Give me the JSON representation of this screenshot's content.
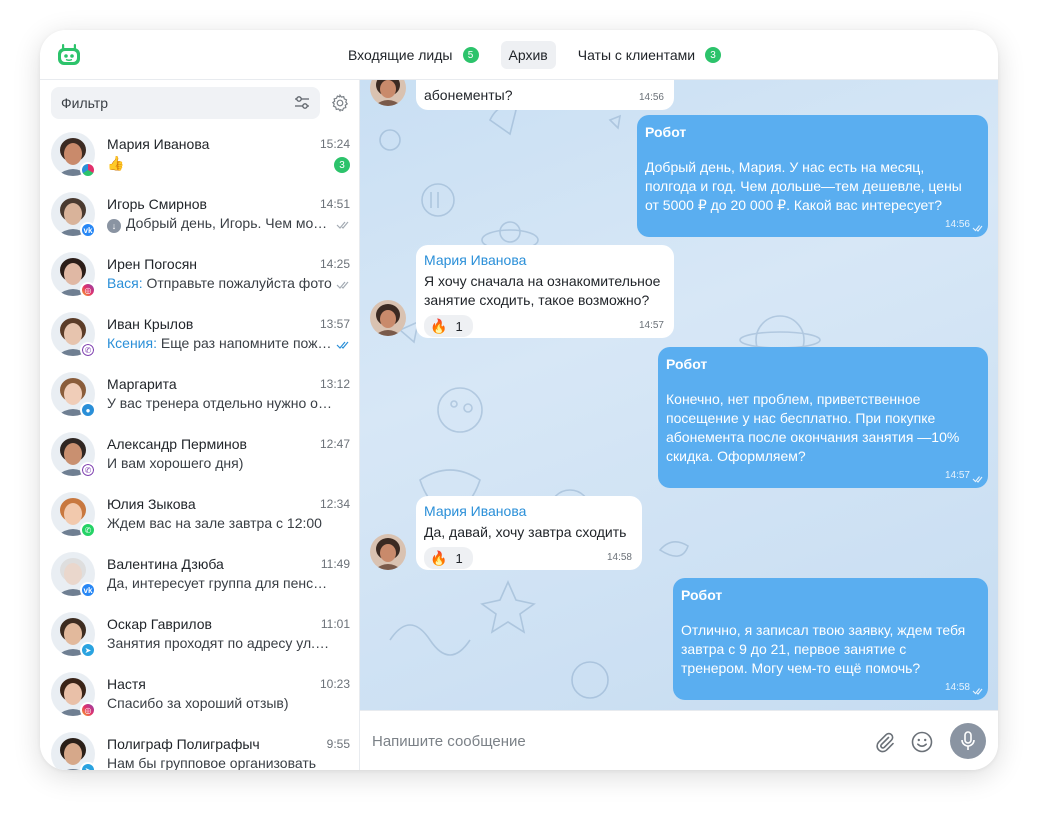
{
  "header": {
    "tabs": [
      {
        "label": "Входящие лиды",
        "badge": "5"
      },
      {
        "label": "Архив",
        "badge": ""
      },
      {
        "label": "Чаты с клиентами",
        "badge": "3"
      }
    ],
    "active_tab": 1,
    "accent_color": "#2cc36b"
  },
  "sidebar": {
    "filter_placeholder": "Фильтр",
    "chats": [
      {
        "name": "Мария Иванова",
        "time": "15:24",
        "sender": "",
        "preview": "👍",
        "unread": "3",
        "network": "multi",
        "status": "unread"
      },
      {
        "name": "Игорь Смирнов",
        "time": "14:51",
        "sender": "",
        "preview": "Добрый день, Игорь. Чем можем помочь?",
        "unread": "",
        "network": "vk",
        "status": "sent"
      },
      {
        "name": "Ирен Погосян",
        "time": "14:25",
        "sender": "Вася:",
        "preview": "Отправьте пожалуйста фото",
        "unread": "",
        "network": "instagram",
        "status": "read"
      },
      {
        "name": "Иван Крылов",
        "time": "13:57",
        "sender": "Ксения:",
        "preview": "Еще раз напомните пожалуйста",
        "unread": "",
        "network": "viber",
        "status": "read-blue"
      },
      {
        "name": "Маргарита",
        "time": "13:12",
        "sender": "",
        "preview": "У вас тренера отдельно нужно оплачивать?",
        "unread": "",
        "network": "max",
        "status": ""
      },
      {
        "name": "Александр Перминов",
        "time": "12:47",
        "sender": "",
        "preview": "И вам хорошего дня)",
        "unread": "",
        "network": "viber",
        "status": ""
      },
      {
        "name": "Юлия Зыкова",
        "time": "12:34",
        "sender": "",
        "preview": "Ждем вас на зале завтра с 12:00",
        "unread": "",
        "network": "whatsapp",
        "status": ""
      },
      {
        "name": "Валентина Дзюба",
        "time": "11:49",
        "sender": "",
        "preview": "Да, интересует группа для пенсионеров",
        "unread": "",
        "network": "vk",
        "status": ""
      },
      {
        "name": "Оскар Гаврилов",
        "time": "11:01",
        "sender": "",
        "preview": "Занятия проходят по адресу ул. Ленина",
        "unread": "",
        "network": "telegram",
        "status": ""
      },
      {
        "name": "Настя",
        "time": "10:23",
        "sender": "",
        "preview": "Спасибо за хороший отзыв)",
        "unread": "",
        "network": "instagram",
        "status": ""
      },
      {
        "name": "Полиграф Полиграфыч",
        "time": "9:55",
        "sender": "",
        "preview": "Нам бы групповое организовать",
        "unread": "",
        "network": "telegram",
        "status": ""
      }
    ]
  },
  "conversation": {
    "messages": [
      {
        "dir": "in",
        "author": "",
        "text": "абонементы?",
        "time": "14:56"
      },
      {
        "dir": "out",
        "author": "Робот",
        "text": "Добрый день, Мария. У нас есть на месяц, полгода и год. Чем дольше—тем дешевле, цены от 5000 ₽ до 20 000 ₽. Какой вас интересует?",
        "time": "14:56"
      },
      {
        "dir": "in",
        "author": "Мария Иванова",
        "text": "Я хочу сначала на ознакомительное занятие сходить, такое возможно?",
        "time": "14:57",
        "reaction": "🔥",
        "reaction_count": "1"
      },
      {
        "dir": "out",
        "author": "Робот",
        "text": "Конечно, нет проблем, приветственное посещение у нас бесплатно. При покупке абонемента после окончания занятия —10% скидка. Оформляем?",
        "time": "14:57"
      },
      {
        "dir": "in",
        "author": "Мария Иванова",
        "text": "Да, давай, хочу завтра сходить",
        "time": "14:58",
        "reaction": "🔥",
        "reaction_count": "1"
      },
      {
        "dir": "out",
        "author": "Робот",
        "text": "Отлично, я записал твою заявку, ждем тебя завтра с 9 до 21, первое занятие с тренером. Могу чем-то ещё помочь?",
        "time": "14:58"
      }
    ]
  },
  "composer": {
    "placeholder": "Напишите сообщение"
  },
  "colors": {
    "bubble_out": "#5aaef0",
    "bubble_in": "#ffffff",
    "link_blue": "#2a8fd8",
    "mic_button": "#8a94a2"
  }
}
